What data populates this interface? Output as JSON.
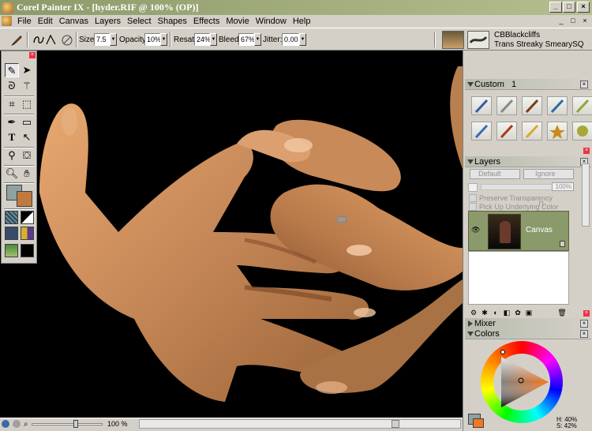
{
  "window": {
    "title": "Corel Painter IX - [hyder.RIF @ 100% (OP)]",
    "controls": [
      "_",
      "□",
      "×"
    ]
  },
  "menu": {
    "items": [
      "File",
      "Edit",
      "Canvas",
      "Layers",
      "Select",
      "Shapes",
      "Effects",
      "Movie",
      "Window",
      "Help"
    ],
    "doc_controls": [
      "_",
      "□",
      "×"
    ]
  },
  "property_bar": {
    "size_label": "Size:",
    "size_value": "7.5",
    "opacity_label": "Opacity:",
    "opacity_value": "10%",
    "resat_label": "Resat:",
    "resat_value": "24%",
    "bleed_label": "Bleed:",
    "bleed_value": "67%",
    "jitter_label": "Jitter:",
    "jitter_value": "0.00",
    "brush_category": "CBBlackcliffs",
    "brush_variant": "Trans Streaky SmearySQ"
  },
  "custom_palette": {
    "title": "Custom",
    "number": "1"
  },
  "layers_palette": {
    "title": "Layers",
    "composite_method": "Default",
    "depth": "Ignore",
    "opacity": "100%",
    "preserve_transparency": "Preserve Transparency",
    "pick_underlying": "Pick Up Underlying Color",
    "layer_name": "Canvas"
  },
  "mixer_palette": {
    "title": "Mixer"
  },
  "colors_palette": {
    "title": "Colors",
    "hue_readout": "H: 40%",
    "sat_readout": "S: 42%",
    "primary_color": "#f07822",
    "secondary_color": "#8ea2a0"
  },
  "status_bar": {
    "zoom": "100 %"
  },
  "toolbox": {
    "tools": [
      "brush-icon",
      "layer-adjuster-icon",
      "lasso-icon",
      "magic-wand-icon",
      "crop-icon",
      "transform-icon",
      "pen-icon",
      "rectangle-icon",
      "text-icon",
      "shape-selection-icon",
      "dropper-icon",
      "paint-bucket-icon",
      "magnifier-icon",
      "grabber-icon"
    ]
  },
  "colors": {
    "title_bar": "#8c9a6a",
    "layer_selected": "#8a9a6a",
    "toolbox_primary": "#c07a40",
    "toolbox_secondary": "#8ea2a0"
  }
}
